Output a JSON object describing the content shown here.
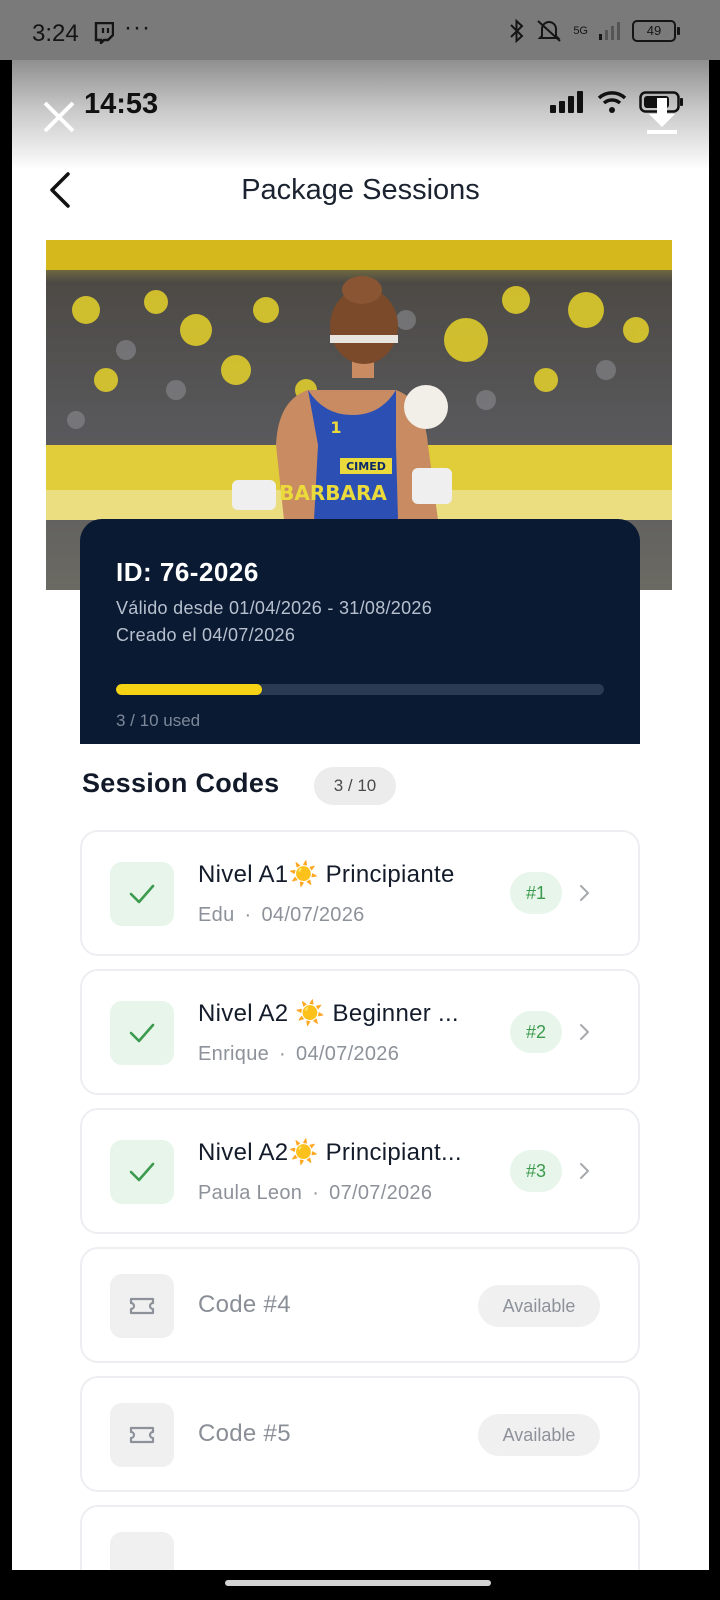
{
  "system_bar": {
    "time": "3:24",
    "dots": "···",
    "network": "5G",
    "battery": "49"
  },
  "inner_status": {
    "time": "14:53"
  },
  "header": {
    "title": "Package Sessions"
  },
  "hero": {
    "jersey_number": "1",
    "jersey_name": "BARBARA",
    "sponsor": "CIMED"
  },
  "package": {
    "id_text": "ID: 76-2026",
    "valid_text": "Válido desde 01/04/2026 - 31/08/2026",
    "created_text": "Creado el 04/07/2026",
    "progress_fraction": 0.3,
    "used_text": "3 / 10 used"
  },
  "section": {
    "title": "Session Codes",
    "count": "3 / 10"
  },
  "used_codes": [
    {
      "title": "Nivel A1☀️ Principiante",
      "user": "Edu",
      "date": "04/07/2026",
      "number": "#1"
    },
    {
      "title": "Nivel A2 ☀️  Beginner ...",
      "user": "Enrique",
      "date": "04/07/2026",
      "number": "#2"
    },
    {
      "title": "Nivel A2☀️ Principiant...",
      "user": "Paula Leon",
      "date": "07/07/2026",
      "number": "#3"
    }
  ],
  "available_codes": [
    {
      "label": "Code #4",
      "status": "Available"
    },
    {
      "label": "Code #5",
      "status": "Available"
    }
  ],
  "colors": {
    "card_bg": "#0b1a33",
    "progress": "#f5d213",
    "success": "#3b9a4d",
    "success_bg": "#e8f5ea"
  }
}
